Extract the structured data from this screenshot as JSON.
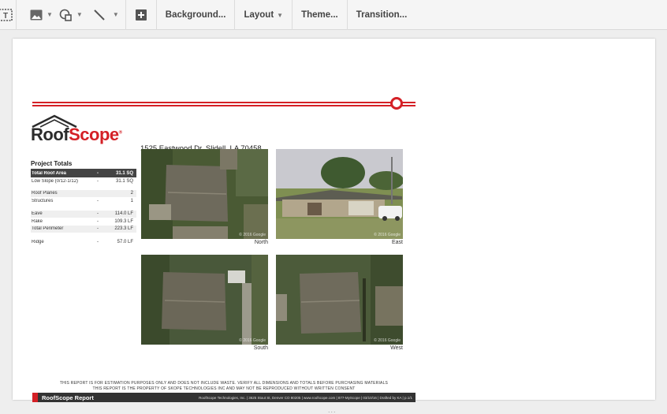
{
  "toolbar": {
    "icons": [
      "text-box-icon",
      "image-icon",
      "shape-icon",
      "line-icon",
      "insert-comment-icon"
    ],
    "background_label": "Background...",
    "layout_label": "Layout",
    "theme_label": "Theme...",
    "transition_label": "Transition..."
  },
  "report": {
    "logo_roof": "Roof",
    "logo_scope": "Scope",
    "logo_reg": "®",
    "address": "1525 Eastwood Dr, Slidell, LA 70458",
    "totals_title": "Project Totals",
    "totals": [
      {
        "label": "Total Roof Area",
        "dash": "-",
        "value": "31.1 SQ"
      },
      {
        "label": "Low Slope (0/12-1/12)",
        "dash": "-",
        "value": "31.1 SQ"
      },
      {
        "label": "Roof Planes",
        "dash": "",
        "value": "2"
      },
      {
        "label": "Structures",
        "dash": "-",
        "value": "1"
      },
      {
        "label": "Eave",
        "dash": "-",
        "value": "114.0 LF"
      },
      {
        "label": "Rake",
        "dash": "-",
        "value": "109.3 LF"
      },
      {
        "label": "Total Perimeter",
        "dash": "-",
        "value": "223.3 LF"
      },
      {
        "label": "Ridge",
        "dash": "-",
        "value": "57.0 LF"
      }
    ],
    "photos": [
      {
        "caption": "North",
        "watermark": "© 2016 Google"
      },
      {
        "caption": "East",
        "watermark": "© 2016 Google"
      },
      {
        "caption": "South",
        "watermark": "© 2016 Google"
      },
      {
        "caption": "West",
        "watermark": "© 2016 Google"
      }
    ],
    "disclaimer_1": "THIS REPORT IS FOR ESTIMATION PURPOSES ONLY AND DOES NOT INCLUDE WASTE. VERIFY ALL DIMENSIONS AND TOTALS BEFORE PURCHASING MATERIALS",
    "disclaimer_2": "THIS REPORT IS THE PROPERTY OF SKOPE TECHNOLOGIES INC AND MAY NOT BE REPRODUCED WITHOUT WRITTEN CONSENT",
    "footer_title": "RoofScope Report",
    "footer_info": "RoofScope Technologies, Inc. | 3625 Stout St, Denver CO 80205 | www.roofscope.com | 877-MyScope | 03/10/16 | Drafted by KA | p.1/1"
  },
  "slide_indicator": "..."
}
